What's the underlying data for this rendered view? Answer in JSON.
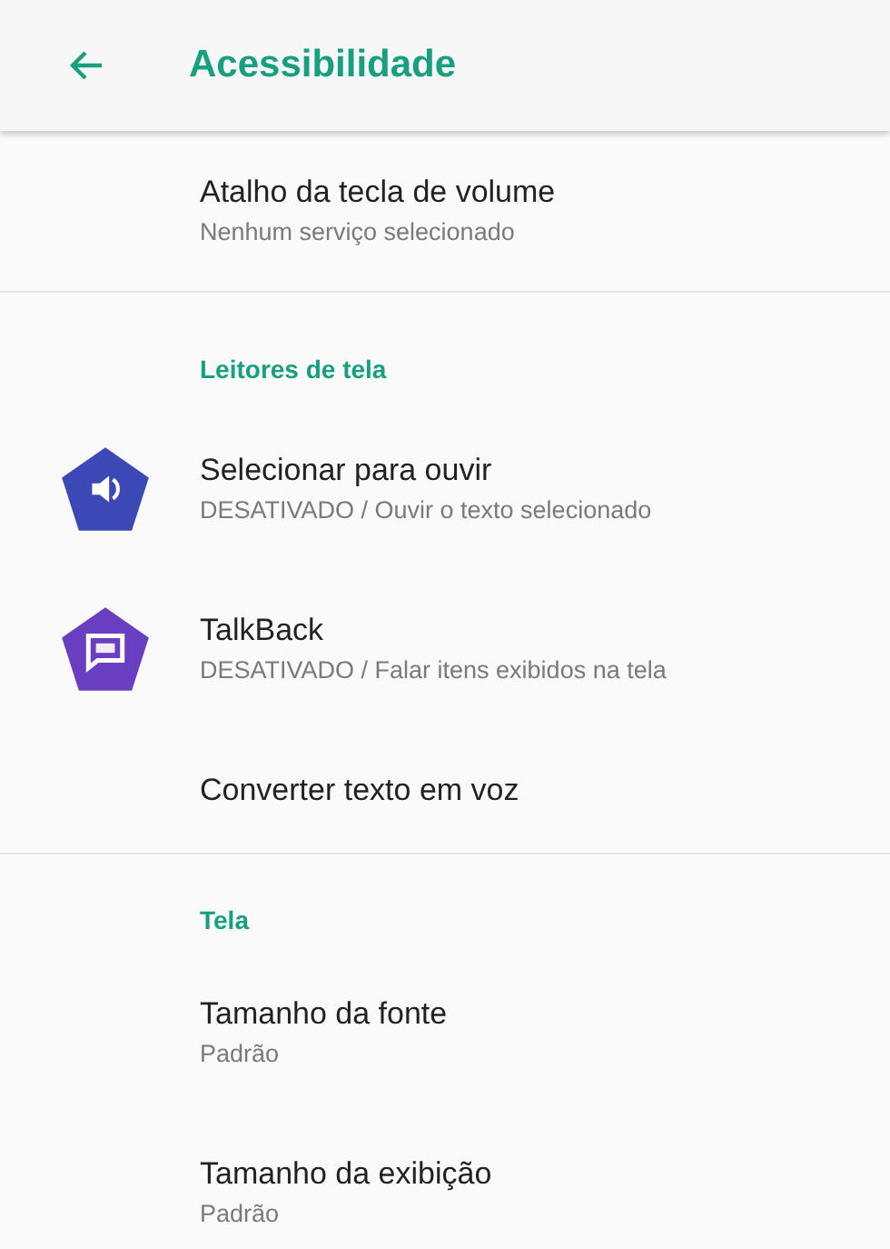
{
  "app_bar": {
    "title": "Acessibilidade"
  },
  "sections": [
    {
      "items": [
        {
          "title": "Atalho da tecla de volume",
          "summary": "Nenhum serviço selecionado"
        }
      ]
    },
    {
      "header": "Leitores de tela",
      "items": [
        {
          "title": "Selecionar para ouvir",
          "summary": "DESATIVADO / Ouvir o texto selecionado",
          "kind": "speaker"
        },
        {
          "title": "TalkBack",
          "summary": "DESATIVADO / Falar itens exibidos na tela",
          "kind": "chat"
        },
        {
          "title": "Converter texto em voz"
        }
      ]
    },
    {
      "header": "Tela",
      "items": [
        {
          "title": "Tamanho da fonte",
          "summary": "Padrão"
        },
        {
          "title": "Tamanho da exibição",
          "summary": "Padrão"
        }
      ]
    }
  ]
}
